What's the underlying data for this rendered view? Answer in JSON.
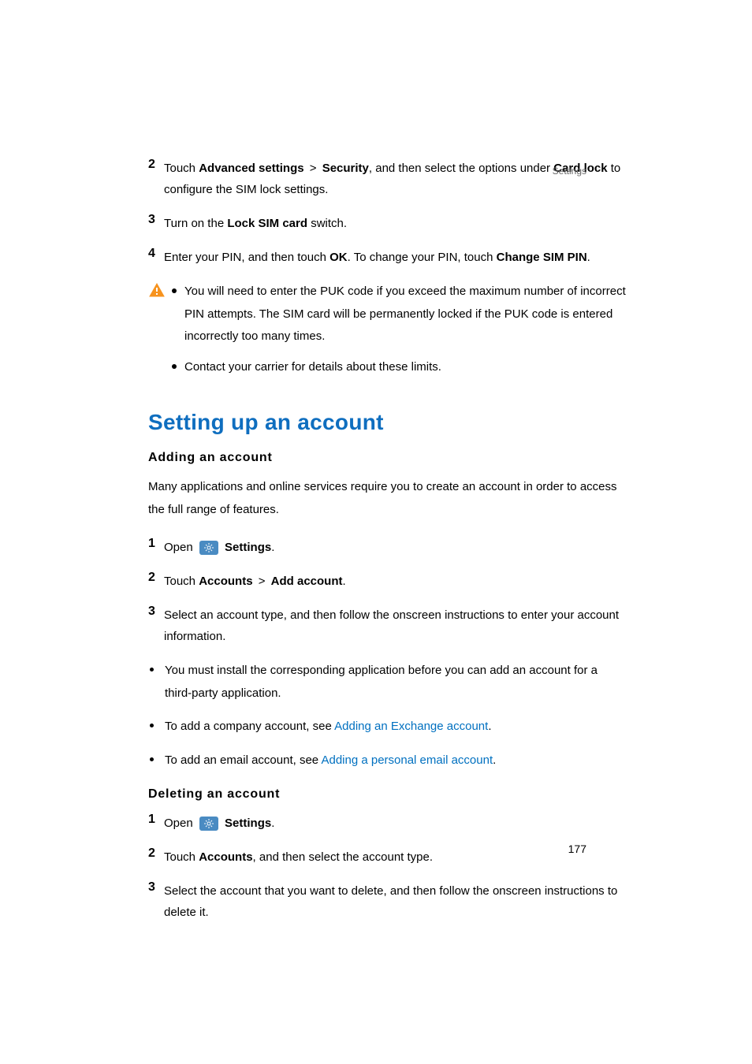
{
  "header": "Settings",
  "pageNumber": "177",
  "section1": {
    "step2": {
      "num": "2",
      "t1": "Touch ",
      "b1": "Advanced settings",
      "g1": " > ",
      "b2": "Security",
      "t2": ", and then select the options under ",
      "b3": "Card lock",
      "t3": " to configure the SIM lock settings."
    },
    "step3": {
      "num": "3",
      "t1": "Turn on the ",
      "b1": "Lock SIM card",
      "t2": " switch."
    },
    "step4": {
      "num": "4",
      "t1": "Enter your PIN, and then touch ",
      "b1": "OK",
      "t2": ". To change your PIN, touch ",
      "b2": "Change SIM PIN",
      "t3": "."
    },
    "warn1": "You will need to enter the PUK code if you exceed the maximum number of incorrect PIN attempts. The SIM card will be permanently locked if the PUK code is entered incorrectly too many times.",
    "warn2": "Contact your carrier for details about these limits."
  },
  "section2": {
    "heading": "Setting up an account",
    "sub1": "Adding an account",
    "intro": "Many applications and online services require you to create an account in order to access the full range of features.",
    "step1": {
      "num": "1",
      "t1": "Open ",
      "b1": "Settings",
      "t2": "."
    },
    "step2": {
      "num": "2",
      "t1": "Touch ",
      "b1": "Accounts",
      "g1": " > ",
      "b2": "Add account",
      "t2": "."
    },
    "step3": {
      "num": "3",
      "t1": "Select an account type, and then follow the onscreen instructions to enter your account information."
    },
    "bullet1": "You must install the corresponding application before you can add an account for a third-party application.",
    "bullet2a": "To add a company account, see ",
    "bullet2b": "Adding an Exchange account",
    "bullet2c": ".",
    "bullet3a": "To add an email account, see ",
    "bullet3b": "Adding a personal email account",
    "bullet3c": ".",
    "sub2": "Deleting an account",
    "del1": {
      "num": "1",
      "t1": "Open ",
      "b1": "Settings",
      "t2": "."
    },
    "del2": {
      "num": "2",
      "t1": "Touch ",
      "b1": "Accounts",
      "t2": ", and then select the account type."
    },
    "del3": {
      "num": "3",
      "t1": "Select the account that you want to delete, and then follow the onscreen instructions to delete it."
    }
  }
}
